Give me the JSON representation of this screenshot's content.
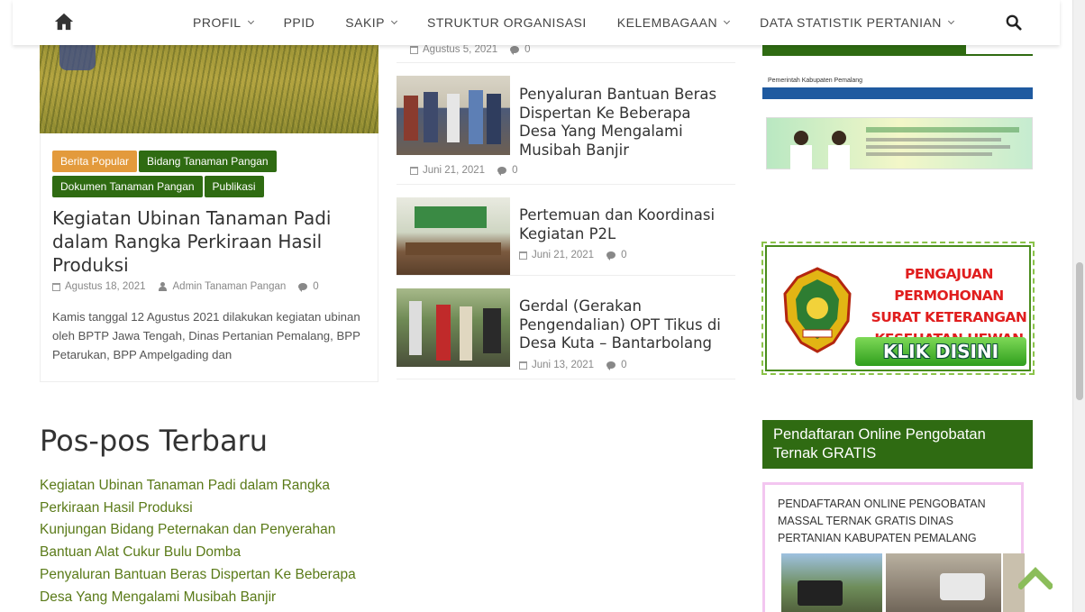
{
  "nav": {
    "items": [
      {
        "label": "PROFIL",
        "has_dropdown": true
      },
      {
        "label": "PPID",
        "has_dropdown": false
      },
      {
        "label": "SAKIP",
        "has_dropdown": true
      },
      {
        "label": "STRUKTUR ORGANISASI",
        "has_dropdown": false
      },
      {
        "label": "KELEMBAGAAN",
        "has_dropdown": true
      },
      {
        "label": "DATA STATISTIK PERTANIAN",
        "has_dropdown": true
      }
    ],
    "home_icon": "home-icon",
    "search_icon": "search-icon"
  },
  "featured": {
    "tags": [
      "Berita Popular",
      "Bidang Tanaman Pangan",
      "Dokumen Tanaman Pangan",
      "Publikasi"
    ],
    "title": "Kegiatan Ubinan Tanaman Padi dalam Rangka Perkiraan Hasil Produksi",
    "date": "Agustus 18, 2021",
    "author": "Admin Tanaman Pangan",
    "comments": "0",
    "excerpt": "Kamis tanggal 12 Agustus 2021 dilakukan kegiatan ubinan oleh BPTP Jawa Tengah, Dinas Pertanian Pemalang, BPP Petarukan, BPP Ampelgading dan"
  },
  "mid_top_meta": {
    "date": "Agustus 5, 2021",
    "comments": "0"
  },
  "mid_posts": [
    {
      "title": "Penyaluran Bantuan Beras Dispertan Ke Beberapa Desa Yang Mengalami Musibah Banjir",
      "date": "Juni 21, 2021",
      "comments": "0"
    },
    {
      "title": "Pertemuan dan Koordinasi Kegiatan P2L",
      "date": "Juni 21, 2021",
      "comments": "0"
    },
    {
      "title": "Gerdal (Gerakan Pengendalian) OPT Tikus di Desa Kuta – Bantarbolang",
      "date": "Juni 13, 2021",
      "comments": "0"
    }
  ],
  "recent": {
    "heading": "Pos-pos Terbaru",
    "items": [
      "Kegiatan Ubinan Tanaman Padi dalam Rangka Perkiraan Hasil Produksi",
      "Kunjungan Bidang Peternakan dan Penyerahan Bantuan Alat Cukur Bulu Domba",
      "Penyaluran Bantuan Beras Dispertan Ke Beberapa Desa Yang Mengalami Musibah Banjir"
    ]
  },
  "sidebar": {
    "site_logo_text": "Pemerintah Kabupaten Pemalang",
    "hewan_banner": {
      "lines": [
        "PENGAJUAN PERMOHONAN",
        "SURAT KETERANGAN",
        "KESEHATAN HEWAN"
      ],
      "button": "KLIK DISINI"
    },
    "pendaftaran_heading": "Pendaftaran Online Pengobatan Ternak GRATIS",
    "pendaftaran_image_text": "PENDAFTARAN ONLINE PENGOBATAN MASSAL TERNAK GRATIS DINAS PERTANIAN KABUPATEN PEMALANG"
  },
  "colors": {
    "brand_green": "#2f6b12",
    "tag_orange": "#e39a3c",
    "link_green": "#5a7a18",
    "banner_red": "#e01e1e"
  },
  "to_top_icon": "chevron-up-icon"
}
